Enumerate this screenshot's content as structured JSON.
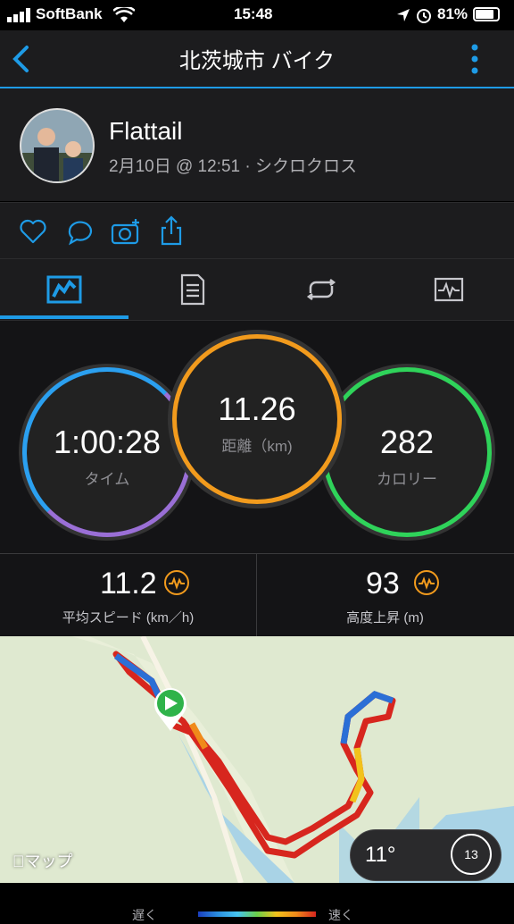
{
  "status_bar": {
    "carrier": "SoftBank",
    "time": "15:48",
    "battery": "81%"
  },
  "nav": {
    "title": "北茨城市 バイク",
    "back_icon": "chevron-left-icon",
    "more_icon": "vertical-dots-icon",
    "accent": "#1e9be6"
  },
  "profile": {
    "name": "Flattail",
    "meta": "2月10日 @ 12:51 · シクロクロス"
  },
  "actions": [
    "heart-icon",
    "comment-icon",
    "add-photo-icon",
    "share-icon"
  ],
  "tabs": [
    "overview-tab",
    "details-tab",
    "laps-tab",
    "charts-tab"
  ],
  "rings": {
    "time": {
      "value": "1:00:28",
      "label": "タイム",
      "color": "#8c78d8"
    },
    "distance": {
      "value": "11.26",
      "label": "距離（km)",
      "color": "#f29b1d"
    },
    "calories": {
      "value": "282",
      "label": "カロリー",
      "color": "#2fd35a"
    }
  },
  "metrics": {
    "avg_speed": {
      "value": "11.2",
      "label": "平均スピード (km／h)"
    },
    "elevation": {
      "value": "93",
      "label": "高度上昇 (m)"
    }
  },
  "map": {
    "attribution": "マップ",
    "temperature": "11°",
    "wind": "13"
  },
  "legend": {
    "slow": "遅く",
    "fast": "速く"
  }
}
